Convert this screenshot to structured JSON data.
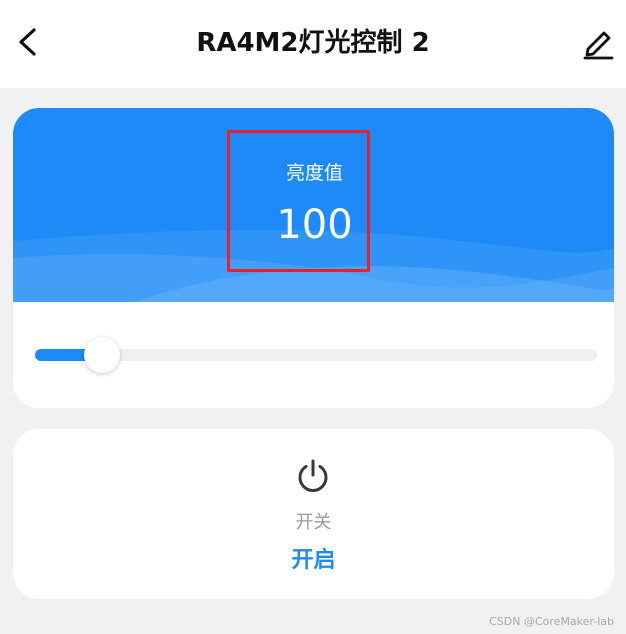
{
  "header": {
    "title": "RA4M2灯光控制 2",
    "back_icon": "chevron-left-icon",
    "edit_icon": "pencil-icon"
  },
  "brightness": {
    "label": "亮度值",
    "value": "100",
    "slider_fraction": 0.12,
    "highlight_color": "#e8202a"
  },
  "switch": {
    "icon": "power-icon",
    "label": "开关",
    "state": "开启"
  },
  "colors": {
    "accent": "#1e8af7",
    "background": "#f1f1f3"
  },
  "watermark": "CSDN @CoreMaker-lab"
}
